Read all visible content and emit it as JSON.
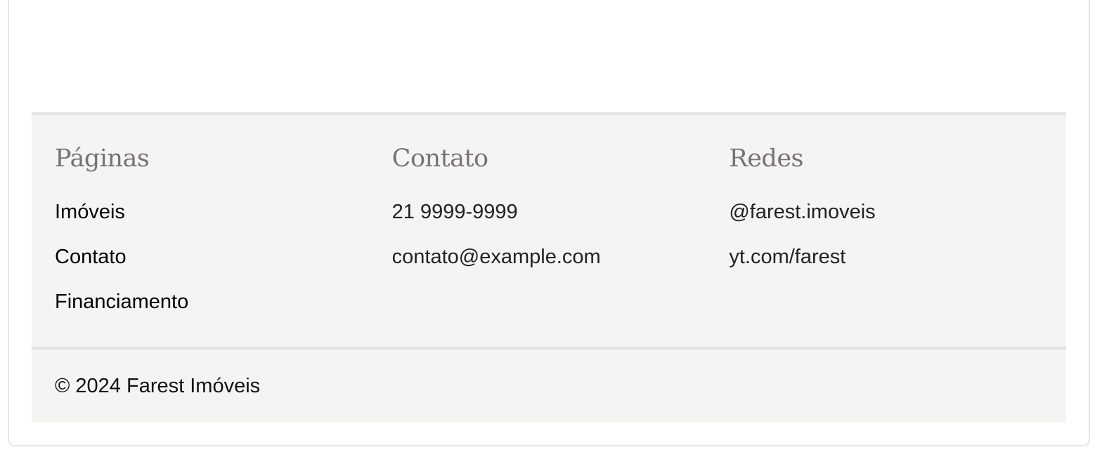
{
  "footer": {
    "columns": [
      {
        "heading": "Páginas",
        "items": [
          "Imóveis",
          "Contato",
          "Financiamento"
        ]
      },
      {
        "heading": "Contato",
        "items": [
          "21 9999-9999",
          "contato@example.com"
        ]
      },
      {
        "heading": "Redes",
        "items": [
          "@farest.imoveis",
          "yt.com/farest"
        ]
      }
    ],
    "copyright": "© 2024 Farest Imóveis"
  },
  "colors": {
    "footer_bg": "#f4f4f2",
    "heading": "#777370",
    "text": "#111111",
    "border": "#e3e3e1"
  }
}
